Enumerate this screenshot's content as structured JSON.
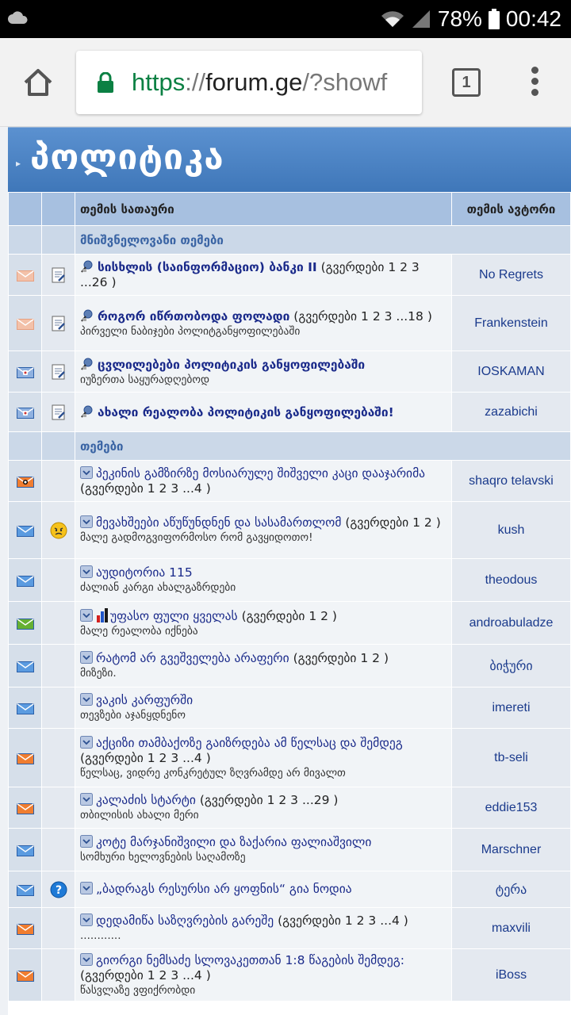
{
  "statusbar": {
    "battery": "78%",
    "time": "00:42"
  },
  "browser": {
    "url_scheme": "https",
    "url_sep": "://",
    "url_host": "forum.ge",
    "url_path": "/?showf",
    "tab_count": "1"
  },
  "forum": {
    "title": "პოლიტიკა",
    "col_topic": "თემის სათაური",
    "col_author": "თემის ავტორი",
    "section_pinned": "მნიშვნელოვანი თემები",
    "section_topics": "თემები",
    "pinned": [
      {
        "title": "სისხლის (საინფორმაციო) ბანკი II",
        "pages_label": "(გვერდები",
        "pages": "1 2 3 ...26",
        "close": ")",
        "desc": "",
        "author": "No Regrets",
        "status": "read"
      },
      {
        "title": "როგორ იწრთობოდა ფოლადი",
        "pages_label": "(გვერდები",
        "pages": "1 2 3 ...18",
        "close": ")",
        "desc": "პირველი ნაბიჯები პოლიტგანყოფილებაში",
        "author": "Frankenstein",
        "status": "read"
      },
      {
        "title": "ცვლილებები პოლიტიკის განყოფილებაში",
        "pages_label": "",
        "pages": "",
        "close": "",
        "desc": "იუზერთა საყურადღებოდ",
        "author": "IOSKAMAN",
        "status": "locked"
      },
      {
        "title": "ახალი რეალობა პოლიტიკის განყოფილებაში!",
        "pages_label": "",
        "pages": "",
        "close": "",
        "desc": "",
        "author": "zazabichi",
        "status": "locked"
      }
    ],
    "topics": [
      {
        "title": "პეკინის გამზირზე მოსიარულე შიშველი კაცი დააჯარიმა",
        "pages_label": "(გვერდები",
        "pages": "1 2 3 ...4",
        "close": ")",
        "desc": "",
        "author": "shaqro telavski",
        "status": "hot"
      },
      {
        "title": "მევახშეები აწუწუნდნენ და სასამართლომ",
        "pages_label": "(გვერდები",
        "pages": "1 2",
        "close": ")",
        "desc": "მალე გადმოგვიფორმოსო რომ გავყიდოთო!",
        "author": "kush",
        "status": "new",
        "mood": "angry-face-icon"
      },
      {
        "title": "აუდიტორია 115",
        "pages_label": "",
        "pages": "",
        "close": "",
        "desc": "ძალიან კარგი ახალგაზრდები",
        "author": "theodous",
        "status": "new"
      },
      {
        "title": "უფასო ფული ყველას",
        "pages_label": "(გვერდები",
        "pages": "1 2",
        "close": ")",
        "desc": "მალე რეალობა იქნება",
        "author": "androabuladze",
        "status": "poll"
      },
      {
        "title": "რატომ არ გვეშველება არაფერი",
        "pages_label": "(გვერდები",
        "pages": "1 2",
        "close": ")",
        "desc": "მიზეზი.",
        "author": "ბიჭური",
        "status": "new"
      },
      {
        "title": "ვაკის კარფურში",
        "pages_label": "",
        "pages": "",
        "close": "",
        "desc": "თევზები აჯანყდნენო",
        "author": "imereti",
        "status": "new"
      },
      {
        "title": "აქციზი თამბაქოზე გაიზრდება ამ წელსაც და შემდეგ",
        "pages_label": "(გვერდები",
        "pages": "1 2 3 ...4",
        "close": ")",
        "desc": "წელსაც, ვიდრე კონკრეტულ ზღვრამდე არ მივალთ",
        "author": "tb-seli",
        "status": "hot-new"
      },
      {
        "title": "კალაძის სტარტი",
        "pages_label": "(გვერდები",
        "pages": "1 2 3 ...29",
        "close": ")",
        "desc": "თბილისის ახალი მერი",
        "author": "eddie153",
        "status": "hot-new"
      },
      {
        "title": "კოტე მარჯანიშვილი და ზაქარია ფალიაშვილი",
        "pages_label": "",
        "pages": "",
        "close": "",
        "desc": "სომხური ხელოვნების საღამოზე",
        "author": "Marschner",
        "status": "new"
      },
      {
        "title": "„ბადრაგს რესურსი არ ყოფნის“ გია ნოდია",
        "pages_label": "",
        "pages": "",
        "close": "",
        "desc": "",
        "author": "ტერა",
        "status": "new",
        "mood": "question-icon"
      },
      {
        "title": "დედამიწა საზღვრების გარეშე",
        "pages_label": "(გვერდები",
        "pages": "1 2 3 ...4",
        "close": ")",
        "desc": "............",
        "author": "maxvili",
        "status": "hot-new"
      },
      {
        "title": "გიორგი ნემსაძე სლოვაკეთთან 1:8 წაგების შემდეგ:",
        "pages_label": "(გვერდები",
        "pages": "1 2 3 ...4",
        "close": ")",
        "desc": "წასვლაზე ვფიქრობდი",
        "author": "iBoss",
        "status": "hot-new"
      }
    ]
  }
}
